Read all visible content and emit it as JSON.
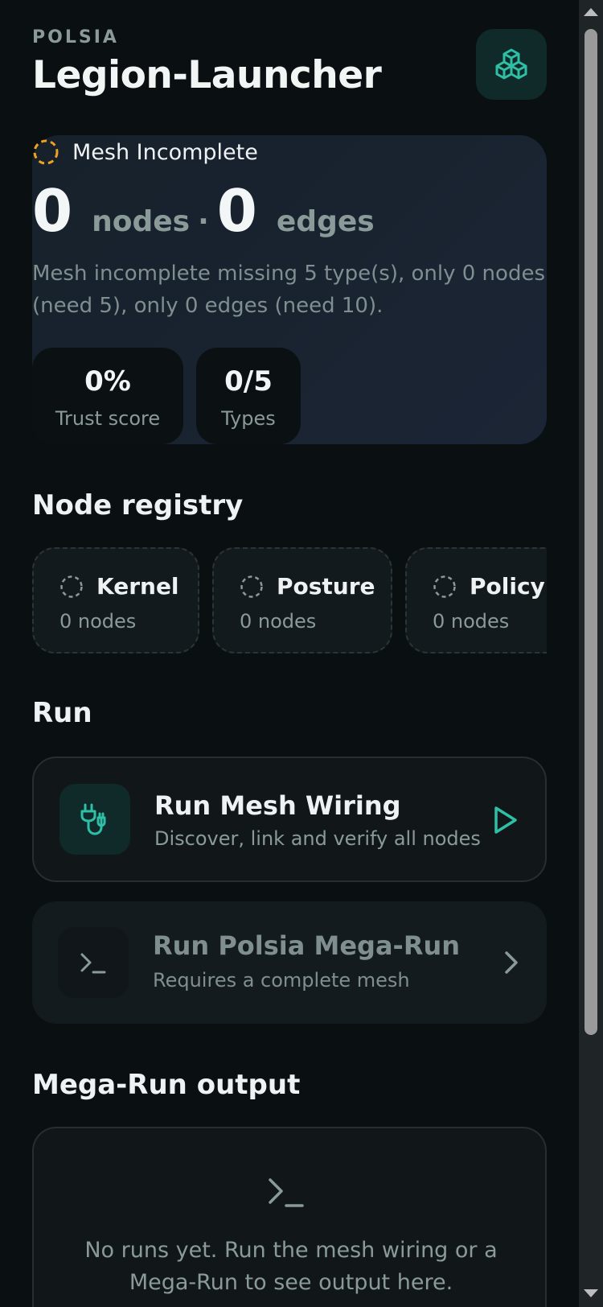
{
  "header": {
    "brand": "POLSIA",
    "title": "Legion-Launcher",
    "logo_icon": "cubes-icon"
  },
  "status": {
    "label": "Mesh Incomplete",
    "nodes_count": "0",
    "nodes_unit": "nodes",
    "separator": "·",
    "edges_count": "0",
    "edges_unit": "edges",
    "description": "Mesh incomplete missing 5 type(s), only 0 nodes (need 5), only 0 edges (need 10).",
    "metrics": [
      {
        "value": "0%",
        "label": "Trust score"
      },
      {
        "value": "0/5",
        "label": "Types"
      }
    ]
  },
  "registry": {
    "heading": "Node registry",
    "items": [
      {
        "name": "Kernel",
        "count": "0 nodes"
      },
      {
        "name": "Posture",
        "count": "0 nodes"
      },
      {
        "name": "Policy",
        "count": "0 nodes"
      }
    ]
  },
  "run": {
    "heading": "Run",
    "mesh_wiring": {
      "title": "Run Mesh Wiring",
      "subtitle": "Discover, link and verify all nodes",
      "icon": "plug-icon"
    },
    "mega_run": {
      "title": "Run Polsia Mega-Run",
      "subtitle": "Requires a complete mesh",
      "icon": "terminal-icon"
    }
  },
  "output": {
    "heading": "Mega-Run output",
    "empty_text": "No runs yet. Run the mesh wiring or a Mega-Run to see output here."
  },
  "colors": {
    "accent": "#2fbfa6",
    "warning": "#f0a020",
    "background": "#0a0f11"
  }
}
